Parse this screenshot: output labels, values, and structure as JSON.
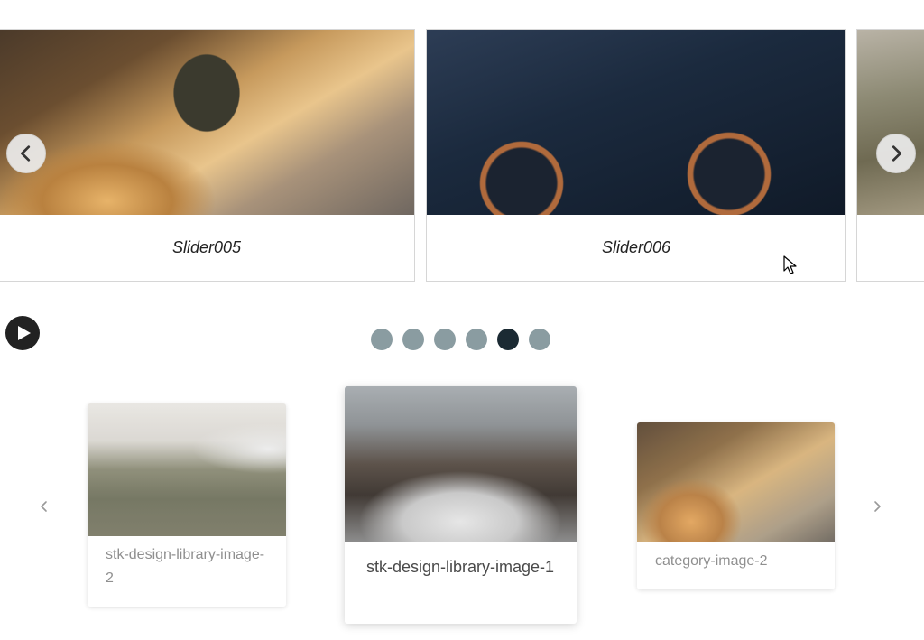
{
  "top_slider": {
    "slides": [
      {
        "caption": "Slider005",
        "image": "mountain-biker-photo"
      },
      {
        "caption": "Slider006",
        "image": "e-bike-photo"
      },
      {
        "caption": "",
        "image": "mountain-landscape-photo"
      }
    ],
    "prev_icon": "chevron-left-icon",
    "next_icon": "chevron-right-icon"
  },
  "controls": {
    "play_icon": "play-icon",
    "dots_count": 6,
    "active_dot": 5
  },
  "carousel": {
    "cards": [
      {
        "label": "stk-design-library-image-2"
      },
      {
        "label": "stk-design-library-image-1"
      },
      {
        "label": "category-image-2"
      }
    ],
    "prev_icon": "chevron-left-icon",
    "next_icon": "chevron-right-icon"
  },
  "colors": {
    "dot_inactive": "#8a9ca1",
    "dot_active": "#1b2a33",
    "play_button": "#222222"
  }
}
